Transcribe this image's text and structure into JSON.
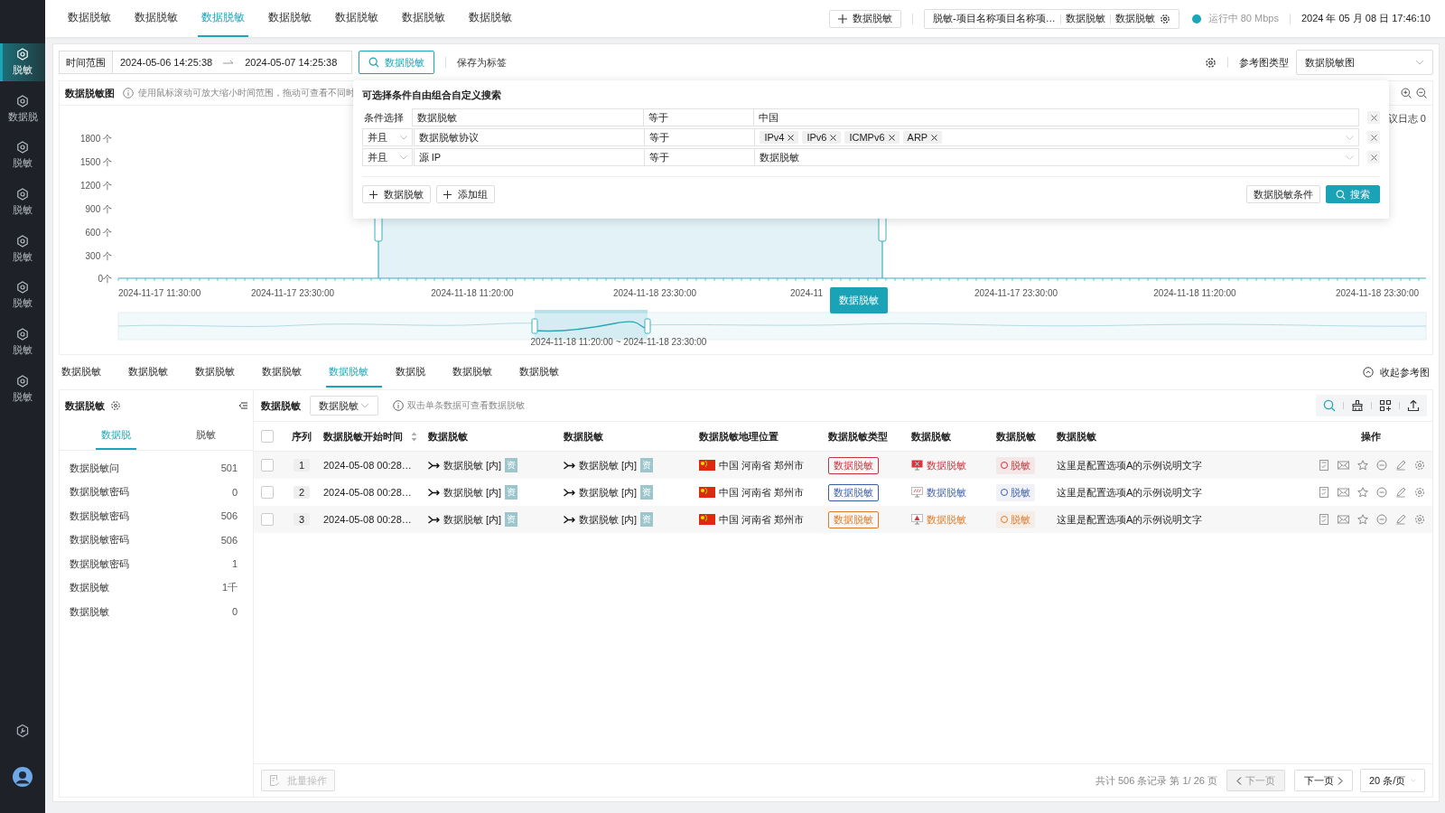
{
  "sidebar": {
    "items": [
      {
        "label": "脱敏",
        "selected": true
      },
      {
        "label": "数据脱",
        "selected": false
      },
      {
        "label": "脱敏",
        "selected": false
      },
      {
        "label": "脱敏",
        "selected": false
      },
      {
        "label": "脱敏",
        "selected": false
      },
      {
        "label": "脱敏",
        "selected": false
      },
      {
        "label": "脱敏",
        "selected": false
      },
      {
        "label": "脱敏",
        "selected": false
      }
    ]
  },
  "top_tabs": [
    {
      "label": "数据脱敏",
      "selected": false
    },
    {
      "label": "数据脱敏",
      "selected": false
    },
    {
      "label": "数据脱敏",
      "selected": true
    },
    {
      "label": "数据脱敏",
      "selected": false
    },
    {
      "label": "数据脱敏",
      "selected": false
    },
    {
      "label": "数据脱敏",
      "selected": false
    },
    {
      "label": "数据脱敏",
      "selected": false
    }
  ],
  "header": {
    "add_button": "数据脱敏",
    "project": {
      "name": "脱敏-项目名称项目名称项…",
      "segments": [
        "数据脱敏",
        "数据脱敏"
      ]
    },
    "status": {
      "text": "运行中 80 Mbps",
      "on": true
    },
    "datetime": "2024 年 05 月 08 日 17:46:10"
  },
  "filter": {
    "time_label": "时间范围",
    "start": "2024-05-06 14:25:38",
    "end": "2024-05-07 14:25:38",
    "search_button": "数据脱敏",
    "save_link": "保存为标签",
    "chart_type_label": "参考图类型",
    "chart_type_value": "数据脱敏图"
  },
  "chart_panel": {
    "title": "数据脱敏图",
    "hint": "使用鼠标滚动可放大缩小时间范围，拖动可查看不同时",
    "side_text": "议日志 0",
    "y_ticks": [
      "1800 个",
      "1500 个",
      "1200 个",
      "900 个",
      "600 个",
      "300 个",
      "0个"
    ],
    "x_ticks": [
      "2024-11-17 11:30:00",
      "2024-11-17 23:30:00",
      "2024-11-18 11:20:00",
      "2024-11-18 23:30:00",
      "2024-11",
      "2024-11-17 23:30:00",
      "2024-11-18 11:20:00",
      "2024-11-18 23:30:00"
    ],
    "tooltip": "数据脱敏",
    "brush_label": "2024-11-18 11:20:00 ~ 2024-11-18 23:30:00"
  },
  "search_popover": {
    "title": "可选择条件自由组合自定义搜索",
    "conditions": [
      {
        "kind": "first",
        "connector": "条件选择",
        "field": "数据脱敏",
        "operator": "等于",
        "value": "中国",
        "dropdown": false
      },
      {
        "kind": "and",
        "connector": "并且",
        "field": "数据脱敏协议",
        "operator": "等于",
        "tags": [
          "IPv4",
          "IPv6",
          "ICMPv6",
          "ARP"
        ],
        "dropdown": true
      },
      {
        "kind": "and",
        "connector": "并且",
        "field": "源 IP",
        "operator": "等于",
        "value": "数据脱敏",
        "dropdown": true
      }
    ],
    "add_condition": "数据脱敏",
    "add_group": "添加组",
    "conditions_button": "数据脱敏条件",
    "search_button": "搜索"
  },
  "lower_tabs": [
    {
      "label": "数据脱敏",
      "selected": false
    },
    {
      "label": "数据脱敏",
      "selected": false
    },
    {
      "label": "数据脱敏",
      "selected": false
    },
    {
      "label": "数据脱敏",
      "selected": false
    },
    {
      "label": "数据脱敏",
      "selected": true
    },
    {
      "label": "数据脱",
      "selected": false
    },
    {
      "label": "数据脱敏",
      "selected": false
    },
    {
      "label": "数据脱敏",
      "selected": false
    }
  ],
  "collapse_button": "收起参考图",
  "side_panel": {
    "title": "数据脱敏",
    "tabs": [
      {
        "label": "数据脱",
        "selected": true
      },
      {
        "label": "脱敏",
        "selected": false
      }
    ],
    "items": [
      {
        "label": "数据脱敏问",
        "count": "501"
      },
      {
        "label": "数据脱敏密码",
        "count": "0"
      },
      {
        "label": "数据脱敏密码",
        "count": "506"
      },
      {
        "label": "数据脱敏密码",
        "count": "506"
      },
      {
        "label": "数据脱敏密码",
        "count": "1"
      },
      {
        "label": "数据脱敏",
        "count": "1千"
      },
      {
        "label": "数据脱敏",
        "count": "0"
      }
    ]
  },
  "table": {
    "toolbar": {
      "label": "数据脱敏",
      "select": "数据脱敏",
      "hint": "双击单条数据可查看数据脱敏"
    },
    "header_checked": false,
    "columns": [
      "序列",
      "数据脱敏开始时间",
      "数据脱敏",
      "数据脱敏",
      "数据脱敏地理位置",
      "数据脱敏类型",
      "数据脱敏",
      "数据脱敏",
      "数据脱敏",
      "操作"
    ],
    "rows": [
      {
        "checked": false,
        "index": "1",
        "start_time": "2024-05-08 00:28…",
        "source": {
          "text": "数据脱敏 [内]",
          "badge": "资"
        },
        "target": {
          "text": "数据脱敏 [内]",
          "badge": "资"
        },
        "location": "中国 河南省 郑州市",
        "type": "数据脱敏",
        "color": "#c8323c",
        "device": {
          "kind": "error",
          "text": "数据脱敏"
        },
        "status": "脱敏",
        "description": "这里是配置选项A的示例说明文字"
      },
      {
        "checked": false,
        "index": "2",
        "start_time": "2024-05-08 00:28…",
        "source": {
          "text": "数据脱敏 [内]",
          "badge": "资"
        },
        "target": {
          "text": "数据脱敏 [内]",
          "badge": "资"
        },
        "location": "中国 河南省 郑州市",
        "type": "数据脱敏",
        "color": "#3b5ea8",
        "device": {
          "kind": "na",
          "text": "数据脱敏"
        },
        "status": "脱敏",
        "description": "这里是配置选项A的示例说明文字"
      },
      {
        "checked": false,
        "index": "3",
        "start_time": "2024-05-08 00:28…",
        "source": {
          "text": "数据脱敏 [内]",
          "badge": "资"
        },
        "target": {
          "text": "数据脱敏 [内]",
          "badge": "资"
        },
        "location": "中国 河南省 郑州市",
        "type": "数据脱敏",
        "color": "#e07a28",
        "device": {
          "kind": "warning",
          "text": "数据脱敏"
        },
        "status": "脱敏",
        "description": "这里是配置选项A的示例说明文字"
      }
    ]
  },
  "footer": {
    "batch_button": {
      "label": "批量操作",
      "disabled": true
    },
    "summary": "共计 506 条记录 第 1/ 26 页",
    "prev": {
      "label": "下一页",
      "disabled": true
    },
    "next": {
      "label": "下一页",
      "disabled": false
    },
    "page_size": "20 条/页"
  }
}
